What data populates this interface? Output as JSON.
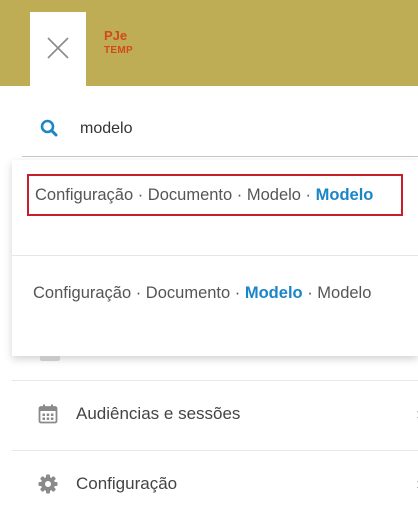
{
  "header": {
    "close_label": "Fechar",
    "logo_line1": "PJe",
    "logo_line2": "TEMP"
  },
  "search": {
    "value": "modelo",
    "placeholder": ""
  },
  "results": [
    {
      "parts": [
        "Configuração · Documento · Modelo · ",
        "Modelo"
      ],
      "p1": "Configuração · Documento · Modelo · ",
      "p2": "Modelo",
      "selected": true
    },
    {
      "p1": "Configuração · Documento · ",
      "p2": "Modelo",
      "p3": " · Modelo",
      "selected": false
    }
  ],
  "menu": {
    "items": [
      {
        "label": "Audiências e sessões",
        "icon": "calendar-icon"
      },
      {
        "label": "Configuração",
        "icon": "gear-icon"
      }
    ]
  },
  "colors": {
    "header_bg": "#bfad55",
    "logo": "#d24a1a",
    "highlight": "#1a85c8",
    "selected_border": "#c81e2a"
  }
}
